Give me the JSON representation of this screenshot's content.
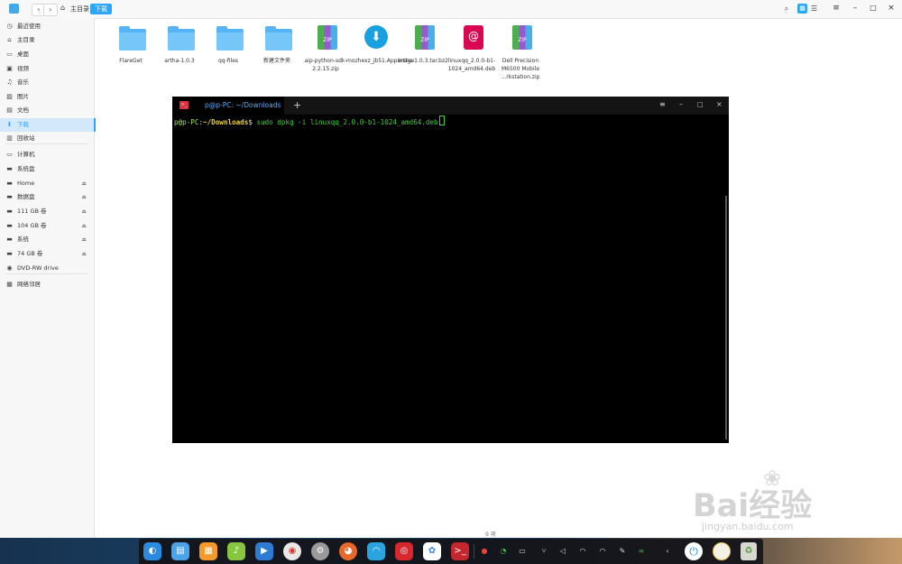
{
  "file_manager": {
    "nav": {
      "back": "‹",
      "forward": "›"
    },
    "breadcrumb": {
      "home_label": "主目录",
      "current_label": "下载"
    },
    "sidebar": [
      {
        "label": "最近使用",
        "icon": "clock-icon"
      },
      {
        "label": "主目录",
        "icon": "home-icon"
      },
      {
        "label": "桌面",
        "icon": "desktop-icon"
      },
      {
        "label": "视频",
        "icon": "video-icon"
      },
      {
        "label": "音乐",
        "icon": "music-icon"
      },
      {
        "label": "图片",
        "icon": "picture-icon"
      },
      {
        "label": "文档",
        "icon": "document-icon"
      },
      {
        "label": "下载",
        "icon": "download-icon",
        "active": true
      },
      {
        "label": "回收站",
        "icon": "trash-icon"
      },
      {
        "label": "计算机",
        "icon": "computer-icon"
      },
      {
        "label": "系统盘",
        "icon": "disk-icon"
      },
      {
        "label": "Home",
        "icon": "disk-icon",
        "eject": true
      },
      {
        "label": "数据盘",
        "icon": "disk-icon",
        "eject": true
      },
      {
        "label": "111 GB 卷",
        "icon": "disk-icon",
        "eject": true
      },
      {
        "label": "104 GB 卷",
        "icon": "disk-icon",
        "eject": true
      },
      {
        "label": "系统",
        "icon": "disk-icon",
        "eject": true
      },
      {
        "label": "74 GB 卷",
        "icon": "disk-icon",
        "eject": true
      },
      {
        "label": "DVD-RW drive",
        "icon": "optical-drive-icon"
      },
      {
        "label": "网络邻居",
        "icon": "network-icon"
      }
    ],
    "files": [
      {
        "name": "FlareGet",
        "kind": "folder"
      },
      {
        "name": "artha-1.0.3",
        "kind": "folder"
      },
      {
        "name": "qq-files",
        "kind": "folder"
      },
      {
        "name": "新建文件夹",
        "kind": "folder"
      },
      {
        "name": "aip-python-sdk-2.2.15.zip",
        "kind": "zip"
      },
      {
        "name": "mozhexz_jb51.AppImage",
        "kind": "appimage"
      },
      {
        "name": "artha-1.0.3.tar.bz2",
        "kind": "zip"
      },
      {
        "name": "linuxqq_2.0.0-b1-1024_amd64.deb",
        "kind": "deb"
      },
      {
        "name": "Dell Precision M6500 Mobile ...rkstation.zip",
        "kind": "zip"
      }
    ],
    "item_count": "9 项",
    "window_controls": {
      "menu": "≡",
      "minimize": "–",
      "maximize": "□",
      "close": "×"
    },
    "zip_label": "ZIP"
  },
  "terminal": {
    "tab_title": "p@p-PC: ~/Downloads",
    "new_tab": "+",
    "prompt_user": "p@p-PC",
    "prompt_sep": ":",
    "prompt_path": "~/Downloads",
    "prompt_symbol": "$ ",
    "command": "sudo dpkg -i linuxqq_2.0.0-b1-1024_amd64.deb",
    "controls": {
      "menu": "≡",
      "minimize": "–",
      "maximize": "□",
      "close": "×"
    }
  },
  "watermark": {
    "main": "Bai经验",
    "sub": "jingyan.baidu.com"
  },
  "dock": {
    "apps": [
      "launcher-icon",
      "file-manager-icon",
      "app-store-icon",
      "music-player-icon",
      "video-player-icon",
      "chrome-icon",
      "settings-icon",
      "firefox-icon",
      "browser-icon",
      "netease-music-icon",
      "baidu-netdisk-icon",
      "terminal-icon"
    ],
    "tray": [
      "record-icon",
      "update-icon",
      "keyboard-icon",
      "usb-icon",
      "volume-icon",
      "wifi-icon",
      "wifi-icon",
      "pen-icon",
      "link-icon",
      "chevron-left-icon"
    ],
    "power": "⏻",
    "time_icon": "clock-icon",
    "trash": "trash-icon"
  },
  "colors": {
    "accent": "#2ca7f8",
    "terminal_bg": "#000000",
    "prompt_user": "#a5e35c",
    "prompt_path": "#f2d534",
    "command": "#3fcf3f"
  }
}
